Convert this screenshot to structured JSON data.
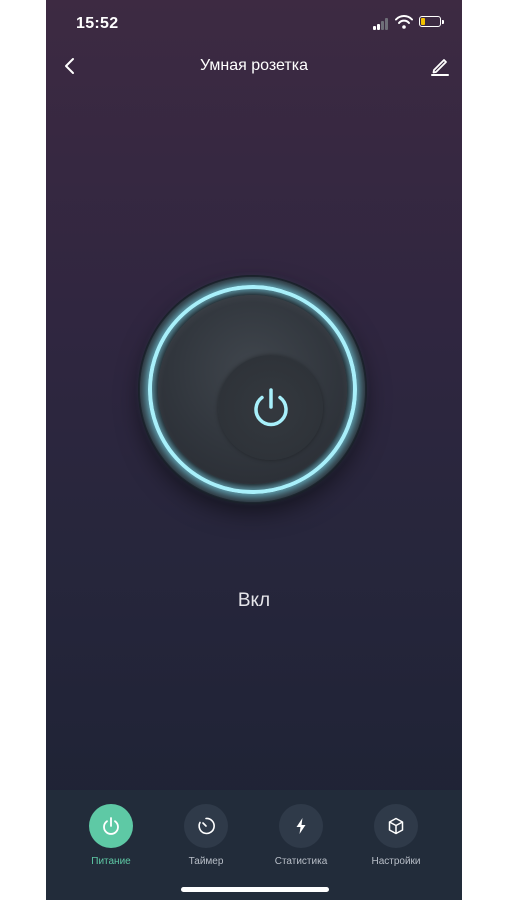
{
  "status_bar": {
    "time": "15:52"
  },
  "header": {
    "title": "Умная розетка",
    "back_icon": "chevron-left-icon",
    "edit_icon": "pencil-icon"
  },
  "power": {
    "state_label": "Вкл",
    "is_on": true,
    "ring_color": "#7ce1f5",
    "icon": "power-icon"
  },
  "tabs": [
    {
      "label": "Питание",
      "icon": "power-icon",
      "active": true
    },
    {
      "label": "Таймер",
      "icon": "timer-icon",
      "active": false
    },
    {
      "label": "Статистика",
      "icon": "lightning-icon",
      "active": false
    },
    {
      "label": "Настройки",
      "icon": "cube-icon",
      "active": false
    }
  ],
  "colors": {
    "accent": "#5ec9a5",
    "battery_fill": "#f2c200"
  }
}
